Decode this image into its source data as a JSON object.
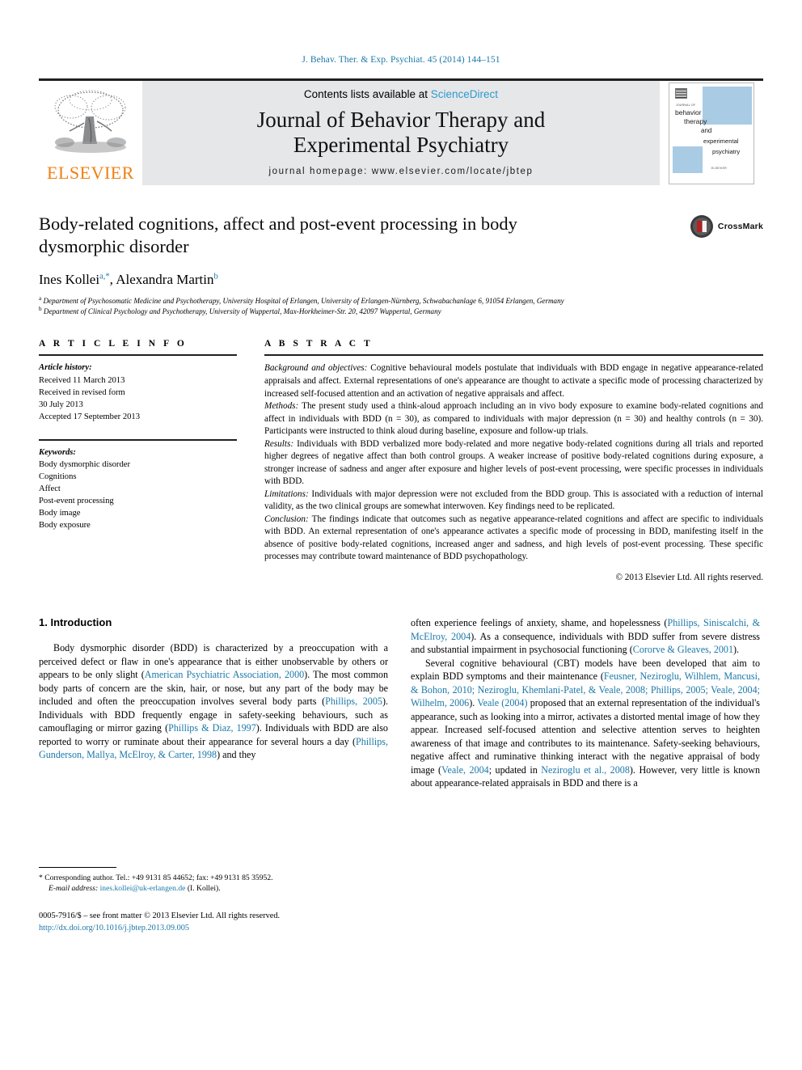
{
  "running_head": "J. Behav. Ther. & Exp. Psychiat. 45 (2014) 144–151",
  "masthead": {
    "publisher_logo_text": "ELSEVIER",
    "contents_prefix": "Contents lists available at",
    "contents_link": "ScienceDirect",
    "journal_title_line1": "Journal of Behavior Therapy and",
    "journal_title_line2": "Experimental Psychiatry",
    "homepage": "journal homepage: www.elsevier.com/locate/jbtep",
    "cover": {
      "line1": "JOURNAL OF",
      "line2": "behavior",
      "line3": "therapy",
      "line4": "and",
      "line5": "experimental",
      "line6": "psychiatry",
      "footer": "ELSEVIER"
    },
    "accent_blue": "#2e9ad0",
    "accent_orange": "#f07f13",
    "band_gray": "#e6e7e8"
  },
  "article": {
    "title": "Body-related cognitions, affect and post-event processing in body dysmorphic disorder",
    "authors_plain": "Ines Kollei, Alexandra Martin",
    "author1": "Ines Kollei",
    "author1_sup": "a,*",
    "author2": "Alexandra Martin",
    "author2_sup": "b",
    "affiliation_a": "Department of Psychosomatic Medicine and Psychotherapy, University Hospital of Erlangen, University of Erlangen-Nürnberg, Schwabachanlage 6, 91054 Erlangen, Germany",
    "affiliation_b": "Department of Clinical Psychology and Psychotherapy, University of Wuppertal, Max-Horkheimer-Str. 20, 42097 Wuppertal, Germany",
    "crossmark_label": "CrossMark"
  },
  "article_info": {
    "heading": "A R T I C L E  I N F O",
    "history_label": "Article history:",
    "history": [
      "Received 11 March 2013",
      "Received in revised form",
      "30 July 2013",
      "Accepted 17 September 2013"
    ],
    "keywords_label": "Keywords:",
    "keywords": [
      "Body dysmorphic disorder",
      "Cognitions",
      "Affect",
      "Post-event processing",
      "Body image",
      "Body exposure"
    ]
  },
  "abstract": {
    "heading": "A B S T R A C T",
    "sections": [
      {
        "label": "Background and objectives:",
        "text": " Cognitive behavioural models postulate that individuals with BDD engage in negative appearance-related appraisals and affect. External representations of one's appearance are thought to activate a specific mode of processing characterized by increased self-focused attention and an activation of negative appraisals and affect."
      },
      {
        "label": "Methods:",
        "text": " The present study used a think-aloud approach including an in vivo body exposure to examine body-related cognitions and affect in individuals with BDD (n = 30), as compared to individuals with major depression (n = 30) and healthy controls (n = 30). Participants were instructed to think aloud during baseline, exposure and follow-up trials."
      },
      {
        "label": "Results:",
        "text": " Individuals with BDD verbalized more body-related and more negative body-related cognitions during all trials and reported higher degrees of negative affect than both control groups. A weaker increase of positive body-related cognitions during exposure, a stronger increase of sadness and anger after exposure and higher levels of post-event processing, were specific processes in individuals with BDD."
      },
      {
        "label": "Limitations:",
        "text": " Individuals with major depression were not excluded from the BDD group. This is associated with a reduction of internal validity, as the two clinical groups are somewhat interwoven. Key findings need to be replicated."
      },
      {
        "label": "Conclusion:",
        "text": " The findings indicate that outcomes such as negative appearance-related cognitions and affect are specific to individuals with BDD. An external representation of one's appearance activates a specific mode of processing in BDD, manifesting itself in the absence of positive body-related cognitions, increased anger and sadness, and high levels of post-event processing. These specific processes may contribute toward maintenance of BDD psychopathology."
      }
    ],
    "copyright": "© 2013 Elsevier Ltd. All rights reserved."
  },
  "introduction": {
    "heading": "1. Introduction",
    "left_paragraph_parts": [
      {
        "t": "Body dysmorphic disorder (BDD) is characterized by a preoccupation with a perceived defect or flaw in one's appearance that is either unobservable by others or appears to be only slight (",
        "cit": false
      },
      {
        "t": "American Psychiatric Association, 2000",
        "cit": true
      },
      {
        "t": "). The most common body parts of concern are the skin, hair, or nose, but any part of the body may be included and often the preoccupation involves several body parts (",
        "cit": false
      },
      {
        "t": "Phillips, 2005",
        "cit": true
      },
      {
        "t": "). Individuals with BDD frequently engage in safety-seeking behaviours, such as camouflaging or mirror gazing (",
        "cit": false
      },
      {
        "t": "Phillips & Diaz, 1997",
        "cit": true
      },
      {
        "t": "). Individuals with BDD are also reported to worry or ruminate about their appearance for several hours a day (",
        "cit": false
      },
      {
        "t": "Phillips, Gunderson, Mallya, McElroy, & Carter, 1998",
        "cit": true
      },
      {
        "t": ") and they",
        "cit": false
      }
    ],
    "right_paragraph1_parts": [
      {
        "t": "often experience feelings of anxiety, shame, and hopelessness (",
        "cit": false
      },
      {
        "t": "Phillips, Siniscalchi, & McElroy, 2004",
        "cit": true
      },
      {
        "t": "). As a consequence, individuals with BDD suffer from severe distress and substantial impairment in psychosocial functioning (",
        "cit": false
      },
      {
        "t": "Cororve & Gleaves, 2001",
        "cit": true
      },
      {
        "t": ").",
        "cit": false
      }
    ],
    "right_paragraph2_parts": [
      {
        "t": "Several cognitive behavioural (CBT) models have been developed that aim to explain BDD symptoms and their maintenance (",
        "cit": false
      },
      {
        "t": "Feusner, Neziroglu, Wilhlem, Mancusi, & Bohon, 2010; Neziroglu, Khemlani-Patel, & Veale, 2008; Phillips, 2005; Veale, 2004; Wilhelm, 2006",
        "cit": true
      },
      {
        "t": "). ",
        "cit": false
      },
      {
        "t": "Veale (2004)",
        "cit": true
      },
      {
        "t": " proposed that an external representation of the individual's appearance, such as looking into a mirror, activates a distorted mental image of how they appear. Increased self-focused attention and selective attention serves to heighten awareness of that image and contributes to its maintenance. Safety-seeking behaviours, negative affect and ruminative thinking interact with the negative appraisal of body image (",
        "cit": false
      },
      {
        "t": "Veale, 2004",
        "cit": true
      },
      {
        "t": "; updated in ",
        "cit": false
      },
      {
        "t": "Neziroglu et al., 2008",
        "cit": true
      },
      {
        "t": "). However, very little is known about appearance-related appraisals in BDD and there is a",
        "cit": false
      }
    ]
  },
  "footnotes": {
    "corresponding_marker": "*",
    "corresponding_text": "Corresponding author. Tel.: +49 9131 85 44652; fax: +49 9131 85 35952.",
    "email_label": "E-mail address:",
    "email": "ines.kollei@uk-erlangen.de",
    "email_person": "(I. Kollei).",
    "front_matter": "0005-7916/$ – see front matter © 2013 Elsevier Ltd. All rights reserved.",
    "doi": "http://dx.doi.org/10.1016/j.jbtep.2013.09.005"
  }
}
